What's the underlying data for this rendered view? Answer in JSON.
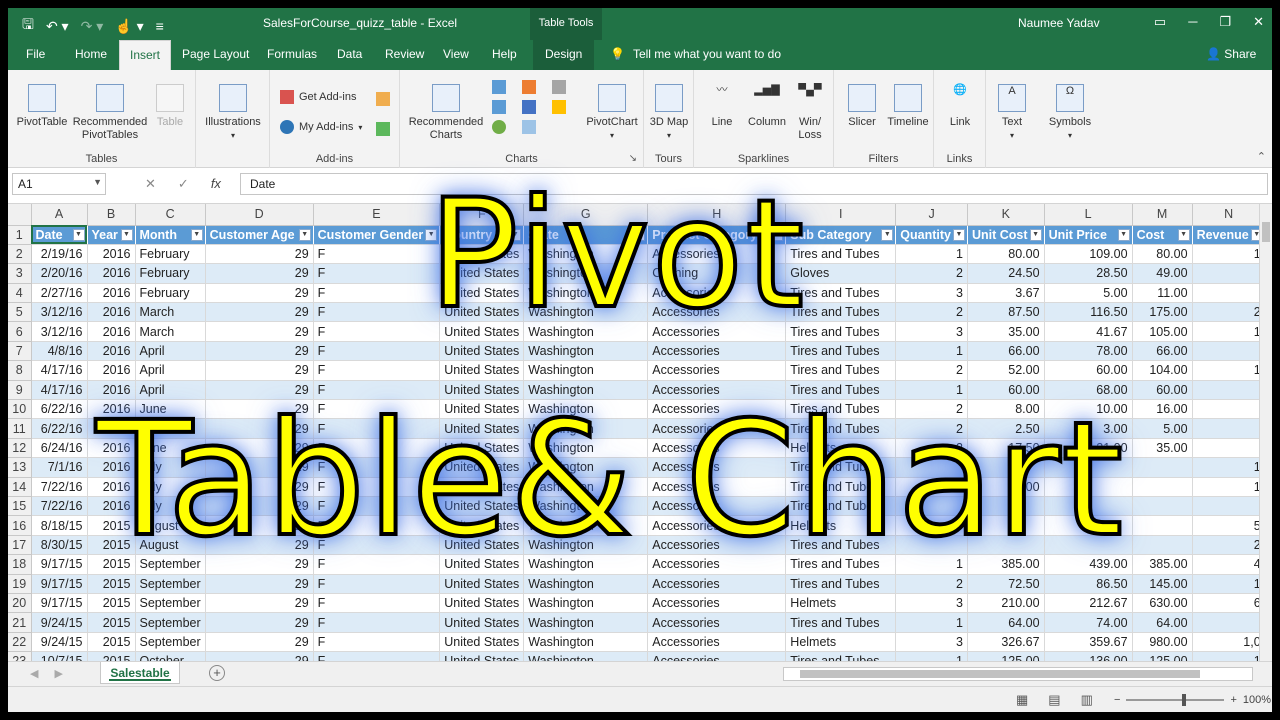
{
  "window": {
    "doc_title": "SalesForCourse_quizz_table  -  Excel",
    "context_tools": "Table Tools",
    "user": "Naumee Yadav"
  },
  "tabs": {
    "items": [
      "File",
      "Home",
      "Insert",
      "Page Layout",
      "Formulas",
      "Data",
      "Review",
      "View",
      "Help"
    ],
    "active": "Insert",
    "design": "Design",
    "tell_me": "Tell me what you want to do",
    "share": "Share"
  },
  "ribbon": {
    "tables": {
      "group": "Tables",
      "pivottable": "PivotTable",
      "recommended": "Recommended PivotTables",
      "table": "Table"
    },
    "illustrations": {
      "label": "Illustrations"
    },
    "addins": {
      "group": "Add-ins",
      "get": "Get Add-ins",
      "my": "My Add-ins"
    },
    "charts": {
      "group": "Charts",
      "recommended": "Recommended Charts",
      "pivotchart": "PivotChart"
    },
    "tours": {
      "group": "Tours",
      "map3d": "3D Map"
    },
    "sparklines": {
      "group": "Sparklines",
      "line": "Line",
      "column": "Column",
      "winloss": "Win/ Loss"
    },
    "filters": {
      "group": "Filters",
      "slicer": "Slicer",
      "timeline": "Timeline"
    },
    "links": {
      "group": "Links",
      "link": "Link"
    },
    "text": {
      "label": "Text"
    },
    "symbols": {
      "label": "Symbols"
    }
  },
  "formula_bar": {
    "name_box": "A1",
    "value": "Date"
  },
  "grid": {
    "columns": [
      "A",
      "B",
      "C",
      "D",
      "E",
      "F",
      "G",
      "H",
      "I",
      "J",
      "K",
      "L",
      "M",
      "N"
    ],
    "headers": [
      "Date",
      "Year",
      "Month",
      "Customer Age",
      "Customer Gender",
      "Country",
      "State",
      "Product Category",
      "Sub Category",
      "Quantity",
      "Unit Cost",
      "Unit Price",
      "Cost",
      "Revenue"
    ],
    "rows": [
      [
        "2/19/16",
        "2016",
        "February",
        "29",
        "F",
        "United States",
        "Washington",
        "Accessories",
        "Tires and Tubes",
        "1",
        "80.00",
        "109.00",
        "80.00",
        "1"
      ],
      [
        "2/20/16",
        "2016",
        "February",
        "29",
        "F",
        "United States",
        "Washington",
        "Clothing",
        "Gloves",
        "2",
        "24.50",
        "28.50",
        "49.00",
        ""
      ],
      [
        "2/27/16",
        "2016",
        "February",
        "29",
        "F",
        "United States",
        "Washington",
        "Accessories",
        "Tires and Tubes",
        "3",
        "3.67",
        "5.00",
        "11.00",
        ""
      ],
      [
        "3/12/16",
        "2016",
        "March",
        "29",
        "F",
        "United States",
        "Washington",
        "Accessories",
        "Tires and Tubes",
        "2",
        "87.50",
        "116.50",
        "175.00",
        "2"
      ],
      [
        "3/12/16",
        "2016",
        "March",
        "29",
        "F",
        "United States",
        "Washington",
        "Accessories",
        "Tires and Tubes",
        "3",
        "35.00",
        "41.67",
        "105.00",
        "1"
      ],
      [
        "4/8/16",
        "2016",
        "April",
        "29",
        "F",
        "United States",
        "Washington",
        "Accessories",
        "Tires and Tubes",
        "1",
        "66.00",
        "78.00",
        "66.00",
        ""
      ],
      [
        "4/17/16",
        "2016",
        "April",
        "29",
        "F",
        "United States",
        "Washington",
        "Accessories",
        "Tires and Tubes",
        "2",
        "52.00",
        "60.00",
        "104.00",
        "1"
      ],
      [
        "4/17/16",
        "2016",
        "April",
        "29",
        "F",
        "United States",
        "Washington",
        "Accessories",
        "Tires and Tubes",
        "1",
        "60.00",
        "68.00",
        "60.00",
        ""
      ],
      [
        "6/22/16",
        "2016",
        "June",
        "29",
        "F",
        "United States",
        "Washington",
        "Accessories",
        "Tires and Tubes",
        "2",
        "8.00",
        "10.00",
        "16.00",
        ""
      ],
      [
        "6/22/16",
        "2016",
        "June",
        "29",
        "F",
        "United States",
        "Washington",
        "Accessories",
        "Tires and Tubes",
        "2",
        "2.50",
        "3.00",
        "5.00",
        ""
      ],
      [
        "6/24/16",
        "2016",
        "June",
        "29",
        "F",
        "United States",
        "Washington",
        "Accessories",
        "Helmets",
        "2",
        "17.50",
        "21.00",
        "35.00",
        ""
      ],
      [
        "7/1/16",
        "2016",
        "July",
        "29",
        "F",
        "United States",
        "Washington",
        "Accessories",
        "Tires and Tubes",
        "",
        "",
        "",
        "",
        "1"
      ],
      [
        "7/22/16",
        "2016",
        "July",
        "29",
        "F",
        "United States",
        "Washington",
        "Accessories",
        "Tires and Tubes",
        "",
        "46.00",
        "",
        "",
        "1"
      ],
      [
        "7/22/16",
        "2016",
        "July",
        "29",
        "F",
        "United States",
        "Washington",
        "Accessories",
        "Tires and Tubes",
        "",
        "",
        "",
        "",
        ""
      ],
      [
        "8/18/15",
        "2015",
        "August",
        "29",
        "F",
        "United States",
        "Washington",
        "Accessories",
        "Helmets",
        "",
        "",
        "",
        "",
        "5"
      ],
      [
        "8/30/15",
        "2015",
        "August",
        "29",
        "F",
        "United States",
        "Washington",
        "Accessories",
        "Tires and Tubes",
        "",
        "",
        "",
        "",
        "2"
      ],
      [
        "9/17/15",
        "2015",
        "September",
        "29",
        "F",
        "United States",
        "Washington",
        "Accessories",
        "Tires and Tubes",
        "1",
        "385.00",
        "439.00",
        "385.00",
        "4"
      ],
      [
        "9/17/15",
        "2015",
        "September",
        "29",
        "F",
        "United States",
        "Washington",
        "Accessories",
        "Tires and Tubes",
        "2",
        "72.50",
        "86.50",
        "145.00",
        "1"
      ],
      [
        "9/17/15",
        "2015",
        "September",
        "29",
        "F",
        "United States",
        "Washington",
        "Accessories",
        "Helmets",
        "3",
        "210.00",
        "212.67",
        "630.00",
        "6"
      ],
      [
        "9/24/15",
        "2015",
        "September",
        "29",
        "F",
        "United States",
        "Washington",
        "Accessories",
        "Tires and Tubes",
        "1",
        "64.00",
        "74.00",
        "64.00",
        ""
      ],
      [
        "9/24/15",
        "2015",
        "September",
        "29",
        "F",
        "United States",
        "Washington",
        "Accessories",
        "Helmets",
        "3",
        "326.67",
        "359.67",
        "980.00",
        "1,0"
      ],
      [
        "10/7/15",
        "2015",
        "October",
        "29",
        "F",
        "United States",
        "Washington",
        "Accessories",
        "Tires and Tubes",
        "1",
        "125.00",
        "136.00",
        "125.00",
        "1"
      ]
    ]
  },
  "sheet": {
    "tab": "Salestable",
    "zoom": "100%"
  },
  "overlay": {
    "line1": "Pivot",
    "line2": "Table& Chart"
  }
}
